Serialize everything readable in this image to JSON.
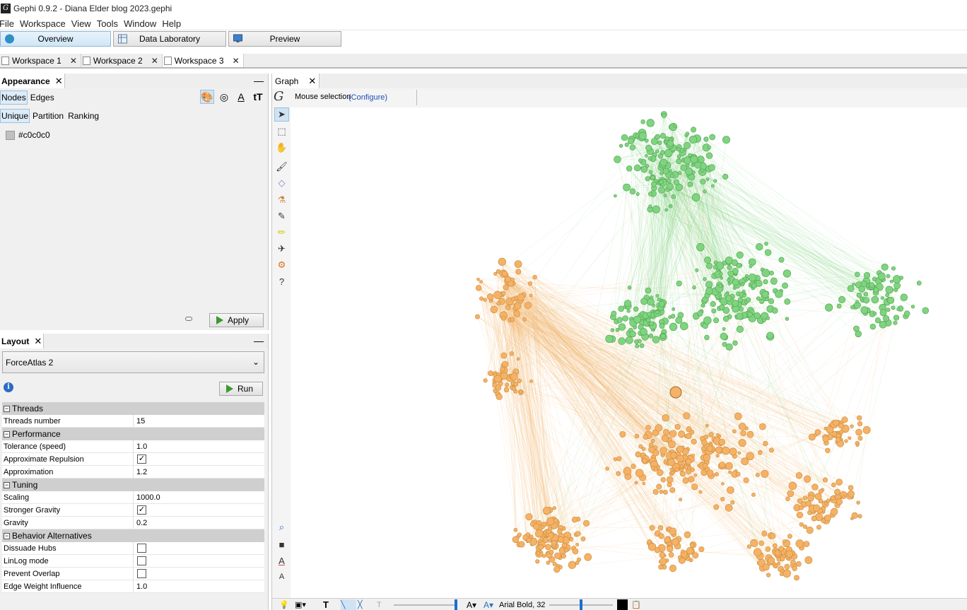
{
  "window": {
    "title": "Gephi 0.9.2 - Diana Elder blog 2023.gephi",
    "app_icon": "gephi-logo-icon"
  },
  "menu": [
    "File",
    "Workspace",
    "View",
    "Tools",
    "Window",
    "Help"
  ],
  "perspectives": [
    {
      "label": "Overview",
      "icon": "globe-icon",
      "active": true
    },
    {
      "label": "Data Laboratory",
      "icon": "table-icon",
      "active": false
    },
    {
      "label": "Preview",
      "icon": "monitor-icon",
      "active": false
    }
  ],
  "workspaces": [
    {
      "label": "Workspace 1",
      "active": false
    },
    {
      "label": "Workspace 2",
      "active": false
    },
    {
      "label": "Workspace 3",
      "active": true
    }
  ],
  "appearance": {
    "title": "Appearance",
    "element_tabs": [
      "Nodes",
      "Edges"
    ],
    "modes": [
      "Unique",
      "Partition",
      "Ranking"
    ],
    "color_value": "#c0c0c0",
    "apply_label": "Apply"
  },
  "layout": {
    "title": "Layout",
    "algorithm": "ForceAtlas 2",
    "run_label": "Run",
    "categories": [
      {
        "name": "Threads",
        "props": [
          {
            "name": "Threads number",
            "value": "15",
            "type": "text"
          }
        ]
      },
      {
        "name": "Performance",
        "props": [
          {
            "name": "Tolerance (speed)",
            "value": "1.0",
            "type": "text"
          },
          {
            "name": "Approximate Repulsion",
            "value": true,
            "type": "checkbox"
          },
          {
            "name": "Approximation",
            "value": "1.2",
            "type": "text"
          }
        ]
      },
      {
        "name": "Tuning",
        "props": [
          {
            "name": "Scaling",
            "value": "1000.0",
            "type": "text"
          },
          {
            "name": "Stronger Gravity",
            "value": true,
            "type": "checkbox"
          },
          {
            "name": "Gravity",
            "value": "0.2",
            "type": "text"
          }
        ]
      },
      {
        "name": "Behavior Alternatives",
        "props": [
          {
            "name": "Dissuade Hubs",
            "value": false,
            "type": "checkbox"
          },
          {
            "name": "LinLog mode",
            "value": false,
            "type": "checkbox"
          },
          {
            "name": "Prevent Overlap",
            "value": false,
            "type": "checkbox"
          },
          {
            "name": "Edge Weight Influence",
            "value": "1.0",
            "type": "text"
          }
        ]
      }
    ]
  },
  "graph": {
    "tab_label": "Graph",
    "mouse_selection": "Mouse selection",
    "configure": "(Configure)",
    "font_label": "Arial Bold, 32",
    "cluster_colors": {
      "green": "#7fd47f",
      "orange": "#f5b266"
    }
  }
}
